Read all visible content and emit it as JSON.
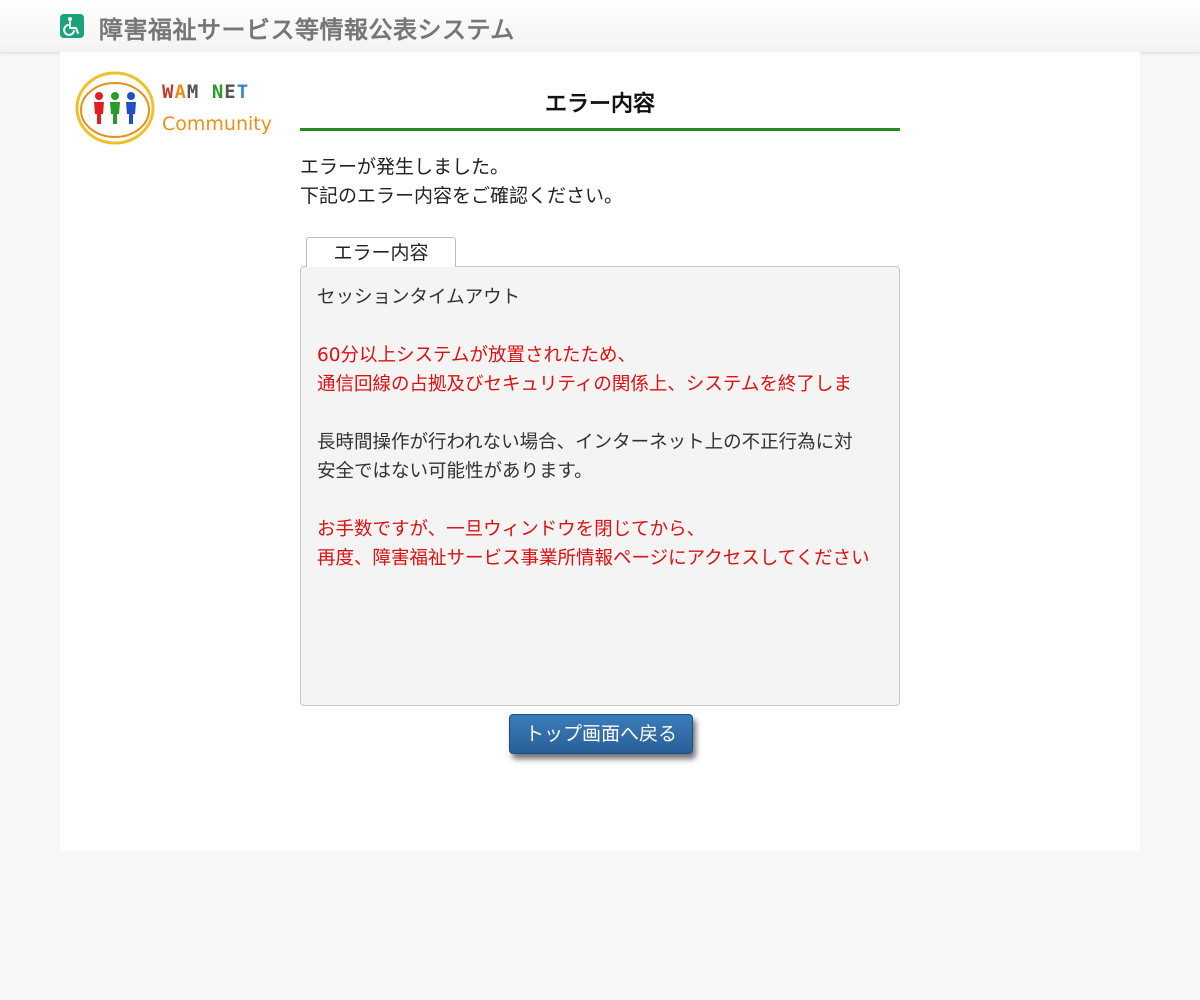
{
  "header": {
    "icon": "wheelchair-icon",
    "title": "障害福祉サービス等情報公表システム"
  },
  "logo": {
    "brand": "WAM NET",
    "brand_letters": [
      "W",
      "A",
      "M",
      " ",
      "N",
      "E",
      "T"
    ],
    "subtitle": "Community"
  },
  "page": {
    "title": "エラー内容",
    "intro_lines": [
      "エラーが発生しました。",
      "下記のエラー内容をご確認ください。"
    ]
  },
  "error": {
    "tab_label": "エラー内容",
    "heading": "セッションタイムアウト",
    "red_lines_1": [
      "60分以上システムが放置されたため、",
      "通信回線の占拠及びセキュリティの関係上、システムを終了しま"
    ],
    "normal_lines": [
      "長時間操作が行われない場合、インターネット上の不正行為に対",
      "安全ではない可能性があります。"
    ],
    "red_lines_2": [
      "お手数ですが、一旦ウィンドウを閉じてから、",
      "再度、障害福祉サービス事業所情報ページにアクセスしてください"
    ]
  },
  "actions": {
    "back_label": "トップ画面へ戻る"
  },
  "colors": {
    "accent_green": "#2a8a25",
    "error_red": "#dd1111",
    "button_blue": "#2a6099",
    "header_text": "#777777"
  }
}
